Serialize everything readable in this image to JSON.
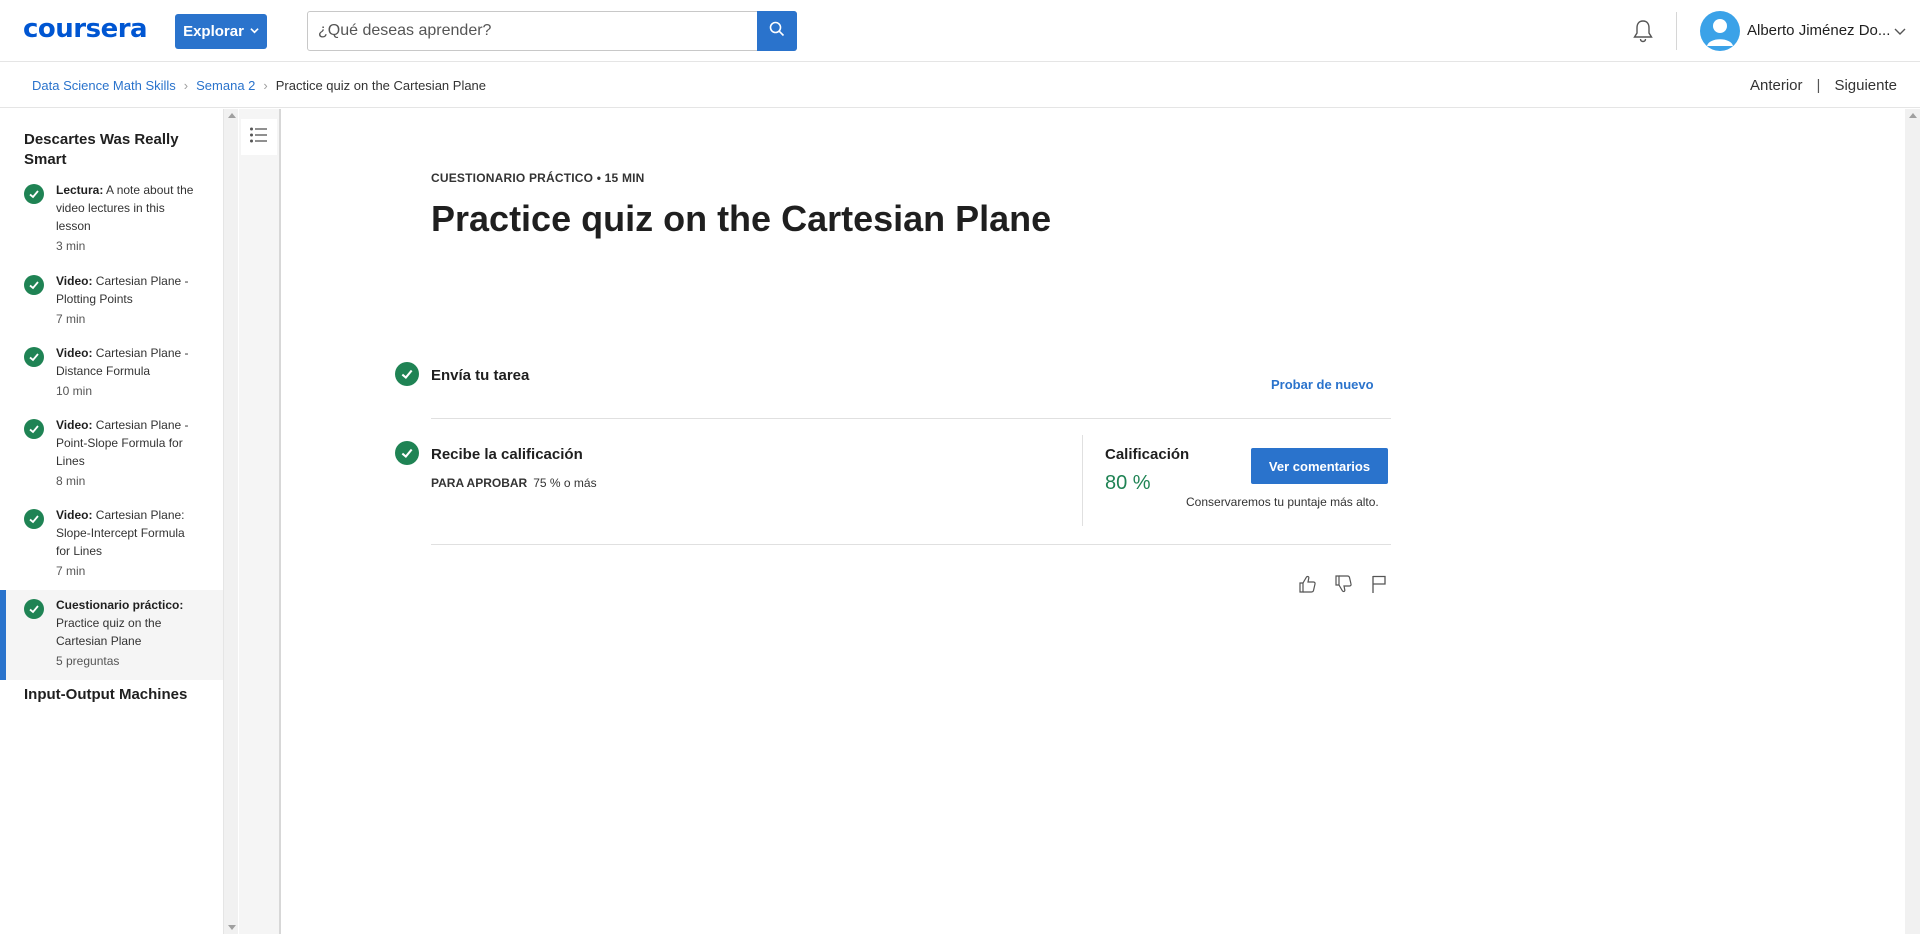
{
  "header": {
    "logo": "coursera",
    "explore_label": "Explorar",
    "search_placeholder": "¿Qué deseas aprender?",
    "user_name": "Alberto Jiménez Do..."
  },
  "breadcrumb": {
    "items": [
      "Data Science Math Skills",
      "Semana 2",
      "Practice quiz on the Cartesian Plane"
    ]
  },
  "nav": {
    "prev": "Anterior",
    "separator": "|",
    "next": "Siguiente"
  },
  "sidebar": {
    "module1_title": "Descartes Was Really Smart",
    "items": [
      {
        "type": "Lectura:",
        "title": "A note about the video lectures in this lesson",
        "meta": "3 min"
      },
      {
        "type": "Video:",
        "title": "Cartesian Plane - Plotting Points",
        "meta": "7 min"
      },
      {
        "type": "Video:",
        "title": "Cartesian Plane - Distance Formula",
        "meta": "10 min"
      },
      {
        "type": "Video:",
        "title": "Cartesian Plane - Point-Slope Formula for Lines",
        "meta": "8 min"
      },
      {
        "type": "Video:",
        "title": "Cartesian Plane: Slope-Intercept Formula for Lines",
        "meta": "7 min"
      },
      {
        "type": "Cuestionario práctico:",
        "title": "Practice quiz on the Cartesian Plane",
        "meta": "5 preguntas"
      }
    ],
    "module2_title": "Input-Output Machines"
  },
  "main": {
    "kicker": "CUESTIONARIO PRÁCTICO • 15 MIN",
    "title": "Practice quiz on the Cartesian Plane",
    "step1_title": "Envía tu tarea",
    "retry_label": "Probar de nuevo",
    "step2_title": "Recibe la calificación",
    "pass_label": "PARA APROBAR",
    "pass_value": "75 % o más",
    "grade_label": "Calificación",
    "grade_value": "80 %",
    "feedback_button": "Ver comentarios",
    "keep_note": "Conservaremos tu puntaje más alto."
  },
  "colors": {
    "accent": "#2a73cc",
    "success": "#1f8354",
    "logo": "#0056d2"
  }
}
